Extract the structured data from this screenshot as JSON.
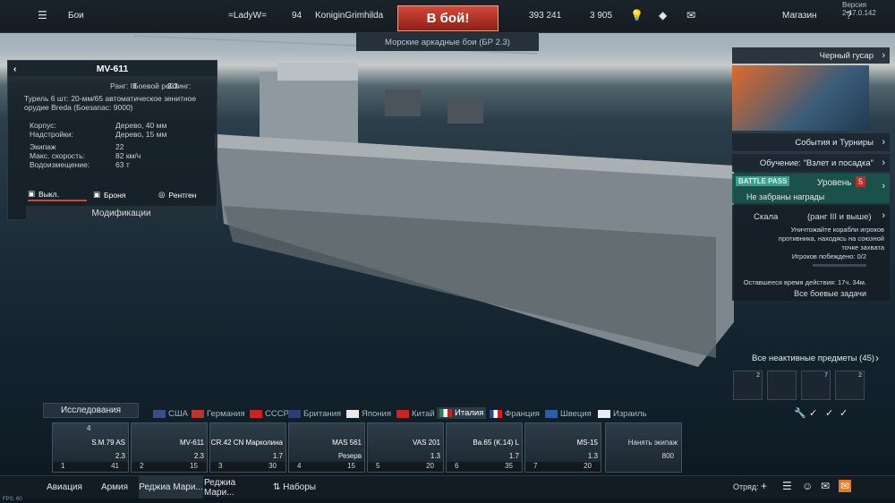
{
  "version": "Версия 2.47.0.142",
  "topbar": {
    "menu_label": "Бои",
    "squad_tag": "=LadyW=",
    "player_level": "94",
    "player_name": "KoniginGrimhilda",
    "battle_button": "В бой!",
    "silver": "393 241",
    "gold": "3 905",
    "shop_label": "Магазин"
  },
  "mode": "Морские аркадные бои (БР 2.3)",
  "vehicle": {
    "name": "MV-611",
    "rank_label": "Ранг: III",
    "br_label": "Боевой рейтинг:",
    "br": "2.3",
    "weapon": "Турель 6 шт: 20-мм/65 автоматическое зенитное орудие Breda (Боезапас: 9000)",
    "stats": [
      [
        "Корпус:",
        "Дерево, 40 мм"
      ],
      [
        "Надстройки:",
        "Дерево, 15 мм"
      ],
      [
        "Экипаж",
        "22"
      ],
      [
        "Макс. скорость:",
        "82 км/ч"
      ],
      [
        "Водоизмещение:",
        "63 т"
      ]
    ],
    "tabs": [
      "Выкл.",
      "Броня",
      "Рентген"
    ],
    "mods": "Модификации"
  },
  "right": {
    "event": "Черный гусар",
    "events_tournaments": "События и Турниры",
    "training": "Обучение: \"Взлет и посадка\"",
    "battle_pass": "BATTLE PASS",
    "level_label": "Уровень",
    "level": "5",
    "rewards": "Не забраны награды",
    "task_title": "Скала",
    "task_rank": "(ранг III и выше)",
    "task_desc": "Уничтожайте корабли игроков противника, находясь на союзной точке захвата",
    "progress": "Игроков побеждено: 0/2",
    "remaining": "Оставшееся время действия: 17ч. 34м.",
    "all_tasks": "Все боевые задачи",
    "inactive": "Все неактивные предметы (45)",
    "medals": [
      "2",
      "",
      "7",
      "2"
    ]
  },
  "research": "Исследования",
  "nations": [
    "США",
    "Германия",
    "СССР",
    "Британия",
    "Япония",
    "Китай",
    "Италия",
    "Франция",
    "Швеция",
    "Израиль"
  ],
  "slots": [
    {
      "name": "S.M.79 AS",
      "br": "2.3",
      "num": "1",
      "count": "41",
      "top": "4"
    },
    {
      "name": "MV-611",
      "br": "2.3",
      "num": "2",
      "count": "15"
    },
    {
      "name": "CR.42 CN Марколина",
      "br": "1.7",
      "num": "3",
      "count": "30"
    },
    {
      "name": "MAS 561",
      "br": "Резерв",
      "num": "4",
      "count": "15"
    },
    {
      "name": "VAS 201",
      "br": "1.3",
      "num": "5",
      "count": "20"
    },
    {
      "name": "Ba.65 (K.14) L",
      "br": "1.7",
      "num": "6",
      "count": "35"
    },
    {
      "name": "MS-15",
      "br": "1.3",
      "num": "7",
      "count": "20"
    }
  ],
  "hire": {
    "label": "Нанять экипаж",
    "cost": "800"
  },
  "bottom_tabs": [
    "Авиация",
    "Армия",
    "Реджиа Мари...",
    "Реджиа Мари...",
    "Наборы"
  ],
  "squad": "Отряд:",
  "fps": "FPS: 60"
}
